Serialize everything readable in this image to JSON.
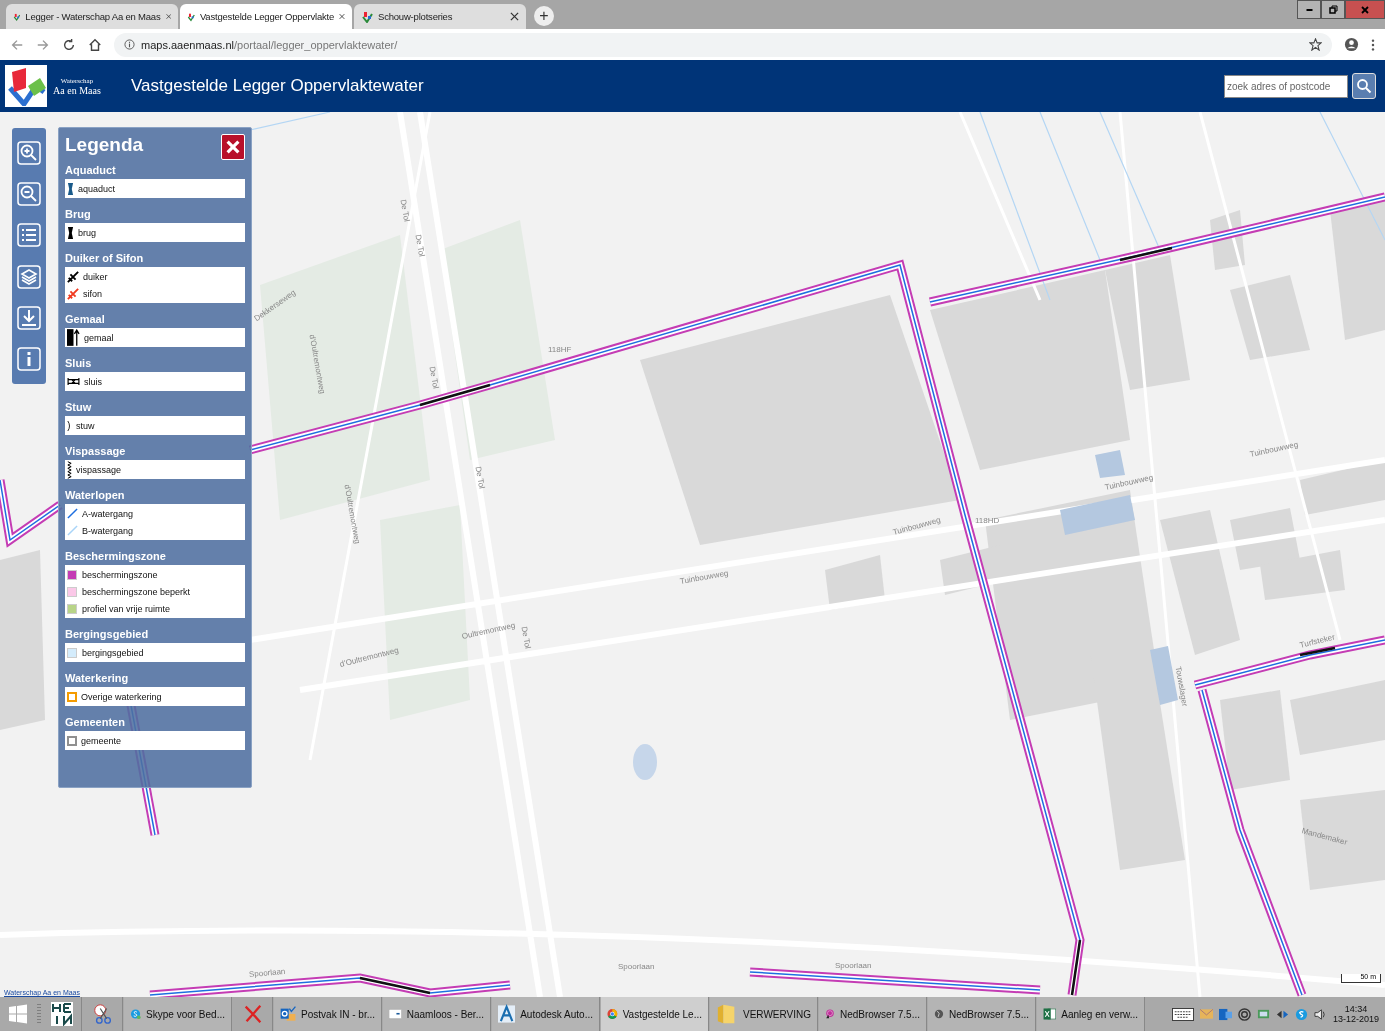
{
  "browser": {
    "tabs": [
      {
        "title": "Legger - Waterschap Aa en Maas",
        "selected": false
      },
      {
        "title": "Vastgestelde Legger Oppervlakte",
        "selected": true
      },
      {
        "title": "Schouw-plotseries",
        "selected": false
      }
    ],
    "new_tab": "+",
    "url": {
      "host": "maps.aaenmaas.nl",
      "path": "/portaal/legger_oppervlaktewater/"
    }
  },
  "header": {
    "logo_text": [
      "Waterschap",
      "Aa en Maas"
    ],
    "title": "Vastgestelde Legger Oppervlaktewater",
    "search": {
      "placeholder": "zoek adres of postcode"
    }
  },
  "legend": {
    "title": "Legenda",
    "sections": [
      {
        "title": "Aquaduct",
        "items": [
          {
            "kind": "aquaduct",
            "label": "aquaduct"
          }
        ]
      },
      {
        "title": "Brug",
        "items": [
          {
            "kind": "brug",
            "label": "brug"
          }
        ]
      },
      {
        "title": "Duiker of Sifon",
        "items": [
          {
            "kind": "duiker",
            "label": "duiker"
          },
          {
            "kind": "sifon",
            "label": "sifon"
          }
        ]
      },
      {
        "title": "Gemaal",
        "items": [
          {
            "kind": "gemaal",
            "label": "gemaal"
          }
        ]
      },
      {
        "title": "Sluis",
        "items": [
          {
            "kind": "sluis",
            "label": "sluis"
          }
        ]
      },
      {
        "title": "Stuw",
        "items": [
          {
            "kind": "stuw",
            "label": "stuw"
          }
        ]
      },
      {
        "title": "Vispassage",
        "items": [
          {
            "kind": "vispassage",
            "label": "vispassage"
          }
        ]
      },
      {
        "title": "Waterlopen",
        "items": [
          {
            "kind": "a-watergang",
            "label": "A-watergang"
          },
          {
            "kind": "b-watergang",
            "label": "B-watergang"
          }
        ]
      },
      {
        "title": "Beschermingszone",
        "items": [
          {
            "kind": "swatch",
            "color": "#c43cb4",
            "label": "beschermingszone"
          },
          {
            "kind": "swatch",
            "color": "#fbc8e8",
            "label": "beschermingszone beperkt"
          },
          {
            "kind": "swatch",
            "color": "#b8d488",
            "label": "profiel van vrije ruimte"
          }
        ]
      },
      {
        "title": "Bergingsgebied",
        "items": [
          {
            "kind": "swatch",
            "color": "#d4ecfc",
            "label": "bergingsgebied"
          }
        ]
      },
      {
        "title": "Waterkering",
        "items": [
          {
            "kind": "outline",
            "color": "#f59c00",
            "label": "Overige waterkering"
          }
        ]
      },
      {
        "title": "Gemeenten",
        "items": [
          {
            "kind": "outline",
            "color": "#909090",
            "label": "gemeente"
          }
        ]
      }
    ]
  },
  "map_labels": [
    {
      "text": "De Tol"
    },
    {
      "text": "De Tol"
    },
    {
      "text": "Dekkerseweg"
    },
    {
      "text": "d'Oultremontweg"
    },
    {
      "text": "118HF"
    },
    {
      "text": "De Tol"
    },
    {
      "text": "De Tol"
    },
    {
      "text": "d'Oultremontweg"
    },
    {
      "text": "Tuinbouwweg"
    },
    {
      "text": "118HD"
    },
    {
      "text": "Tuinbouwweg"
    },
    {
      "text": "Tuinbouwweg"
    },
    {
      "text": "Tuinbouwweg"
    },
    {
      "text": "Oultremontweg"
    },
    {
      "text": "De Tol"
    },
    {
      "text": "d'Oultremontweg"
    },
    {
      "text": "Spoorlaan"
    },
    {
      "text": "Spoorlaan"
    },
    {
      "text": "Spoorlaan"
    },
    {
      "text": "Touwslager"
    },
    {
      "text": "Turfsteker"
    },
    {
      "text": "Mandemaker"
    }
  ],
  "scale": "50 m",
  "credit": "Waterschap Aa en Maas",
  "taskbar": {
    "apps": [
      {
        "kind": "hein"
      },
      {
        "kind": "snip"
      },
      {
        "kind": "skype",
        "label": "Skype voor Bed..."
      },
      {
        "kind": "x"
      },
      {
        "kind": "outlook",
        "label": "Postvak IN - br..."
      },
      {
        "kind": "doc",
        "label": "Naamloos - Ber..."
      },
      {
        "kind": "autodesk",
        "label": "Autodesk Auto..."
      },
      {
        "kind": "chrome",
        "label": "Vastgestelde Le..."
      },
      {
        "kind": "folder",
        "label": "VERWERVING"
      },
      {
        "kind": "ned1",
        "label": "NedBrowser 7.5..."
      },
      {
        "kind": "ned2",
        "label": "NedBrowser 7.5..."
      },
      {
        "kind": "excel",
        "label": "Aanleg en verw..."
      }
    ],
    "time": "14:34",
    "date": "13-12-2019"
  }
}
